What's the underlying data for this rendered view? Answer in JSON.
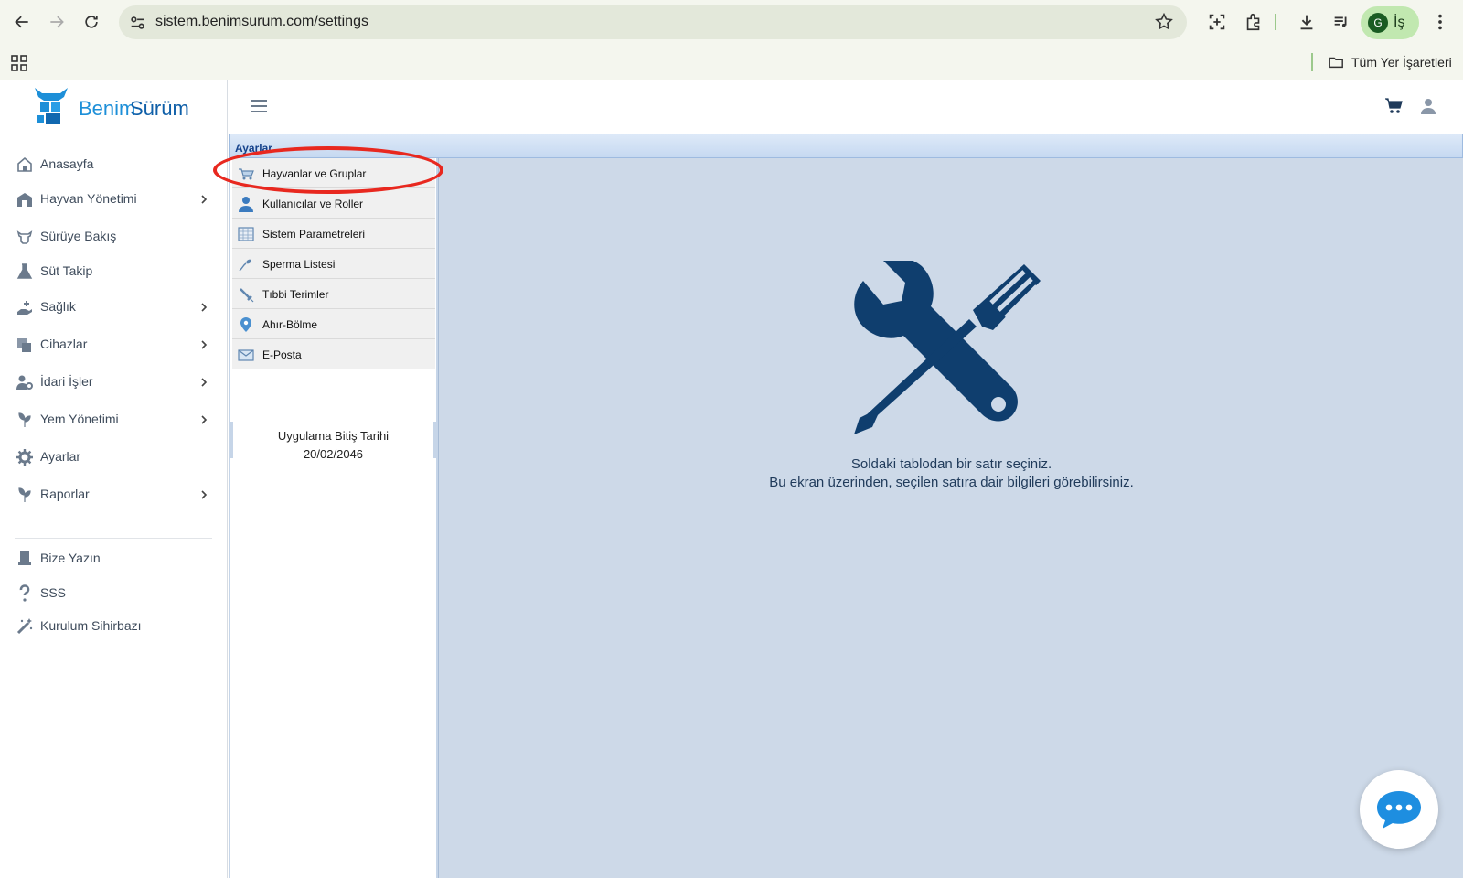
{
  "browser": {
    "url": "sistem.benimsurum.com/settings",
    "profile_initial": "G",
    "profile_name": "İş",
    "bookmarks_folder": "Tüm Yer İşaretleri"
  },
  "logo": {
    "part1": "Benim",
    "part2": "Sürüm"
  },
  "sidebar": {
    "items": [
      {
        "label": "Anasayfa",
        "icon": "home-icon",
        "has_submenu": false
      },
      {
        "label": "Hayvan Yönetimi",
        "icon": "barn-icon",
        "has_submenu": true
      },
      {
        "label": "Sürüye Bakış",
        "icon": "cow-icon",
        "has_submenu": false
      },
      {
        "label": "Süt Takip",
        "icon": "flask-icon",
        "has_submenu": false
      },
      {
        "label": "Sağlık",
        "icon": "health-hand-icon",
        "has_submenu": true
      },
      {
        "label": "Cihazlar",
        "icon": "devices-icon",
        "has_submenu": true
      },
      {
        "label": "İdari İşler",
        "icon": "user-gear-icon",
        "has_submenu": true
      },
      {
        "label": "Yem Yönetimi",
        "icon": "seedling-icon",
        "has_submenu": true
      },
      {
        "label": "Ayarlar",
        "icon": "gear-icon",
        "has_submenu": false
      },
      {
        "label": "Raporlar",
        "icon": "seedling-icon",
        "has_submenu": true
      }
    ],
    "bottom_items": [
      {
        "label": "Bize Yazın",
        "icon": "contact-icon"
      },
      {
        "label": "SSS",
        "icon": "question-icon"
      },
      {
        "label": "Kurulum Sihirbazı",
        "icon": "wand-icon"
      }
    ]
  },
  "settings": {
    "title": "Ayarlar",
    "items": [
      {
        "label": "Hayvanlar ve Gruplar",
        "icon": "cart-animals-icon"
      },
      {
        "label": "Kullanıcılar ve Roller",
        "icon": "user-icon"
      },
      {
        "label": "Sistem Parametreleri",
        "icon": "table-icon"
      },
      {
        "label": "Sperma Listesi",
        "icon": "sperm-icon"
      },
      {
        "label": "Tıbbi Terimler",
        "icon": "syringe-icon"
      },
      {
        "label": "Ahır-Bölme",
        "icon": "location-pin-icon"
      },
      {
        "label": "E-Posta",
        "icon": "envelope-icon"
      }
    ],
    "expiry_label": "Uygulama Bitiş Tarihi",
    "expiry_date": "20/02/2046",
    "info_line1": "Soldaki tablodan bir satır seçiniz.",
    "info_line2": "Bu ekran üzerinden, seçilen satıra dair bilgileri görebilirsiniz."
  },
  "colors": {
    "accent": "#0f3e6e",
    "logo_blue": "#1d8fd8",
    "highlight": "#e8281f",
    "content_bg": "#cdd9e8"
  }
}
